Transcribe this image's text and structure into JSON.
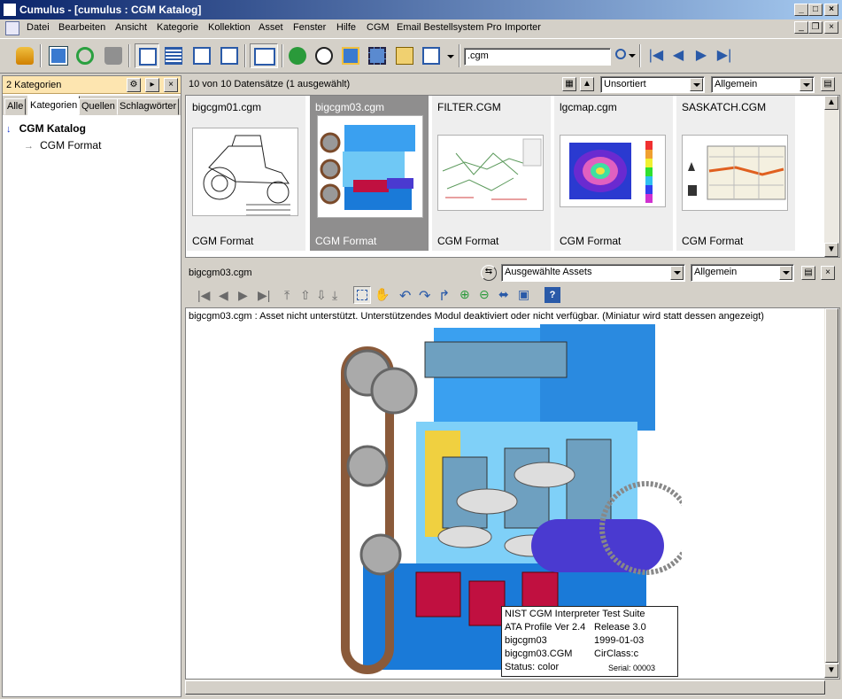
{
  "window": {
    "title": "Cumulus - [cumulus : CGM Katalog]"
  },
  "menu": [
    "Datei",
    "Bearbeiten",
    "Ansicht",
    "Kategorie",
    "Kollektion",
    "Asset",
    "Fenster",
    "Hilfe",
    "CGM",
    "Email Bestellsystem Pro",
    "Importer"
  ],
  "toolbar": {
    "search_value": ".cgm"
  },
  "left_panel": {
    "header": "2 Kategorien",
    "tabs": [
      "Alle",
      "Kategorien",
      "Quellen",
      "Schlagwörter"
    ],
    "active_tab": "Kategorien",
    "tree": [
      {
        "label": "CGM Katalog",
        "level": 0
      },
      {
        "label": "CGM Format",
        "level": 1
      }
    ]
  },
  "records": {
    "status": "10 von 10 Datensätze (1 ausgewählt)",
    "sort": "Unsortiert",
    "view": "Allgemein",
    "items": [
      {
        "name": "bigcgm01.cgm",
        "format": "CGM Format",
        "selected": false
      },
      {
        "name": "bigcgm03.cgm",
        "format": "CGM Format",
        "selected": true
      },
      {
        "name": "FILTER.CGM",
        "format": "CGM Format",
        "selected": false
      },
      {
        "name": "lgcmap.cgm",
        "format": "CGM Format",
        "selected": false
      },
      {
        "name": "SASKATCH.CGM",
        "format": "CGM Format",
        "selected": false
      }
    ]
  },
  "preview": {
    "filename": "bigcgm03.cgm",
    "assets_select": "Ausgewählte Assets",
    "view": "Allgemein",
    "message": "bigcgm03.cgm : Asset nicht unterstützt. Unterstützendes Modul deaktiviert oder nicht verfügbar. (Miniatur wird statt dessen angezeigt)",
    "info_box": [
      [
        "NIST CGM Interpreter Test Suite",
        ""
      ],
      [
        "ATA Profile Ver 2.4",
        "Release 3.0"
      ],
      [
        "bigcgm03",
        "1999-01-03"
      ],
      [
        "bigcgm03.CGM",
        "CirClass:c"
      ],
      [
        "Status: color",
        "Serial: 00003"
      ]
    ]
  }
}
